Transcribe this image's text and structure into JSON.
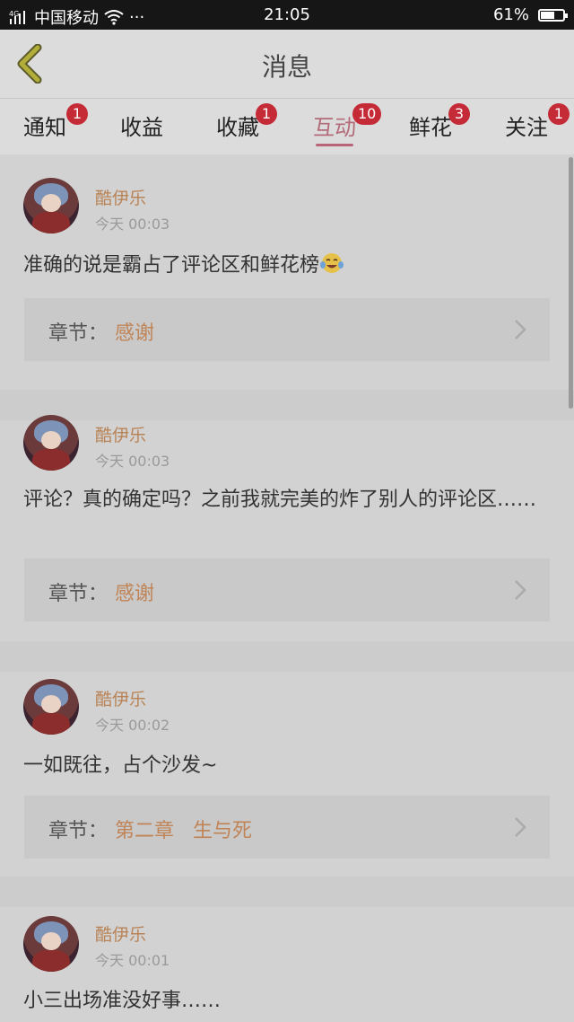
{
  "status_bar": {
    "signal_label": "4G",
    "carrier": "中国移动",
    "dots": "···",
    "time": "21:05",
    "battery_percent": "61%",
    "battery_level": 0.61
  },
  "header": {
    "title": "消息"
  },
  "tabs": [
    {
      "label": "通知",
      "badge": "1"
    },
    {
      "label": "收益",
      "badge": ""
    },
    {
      "label": "收藏",
      "badge": "1"
    },
    {
      "label": "互动",
      "badge": "10",
      "active": true
    },
    {
      "label": "鲜花",
      "badge": "3"
    },
    {
      "label": "关注",
      "badge": "1"
    }
  ],
  "messages": [
    {
      "user": "酷伊乐",
      "time": "今天 00:03",
      "text": "准确的说是霸占了评论区和鲜花榜",
      "emoji": "laughing-crying-emoji",
      "chapter_label": "章节：",
      "chapter": "感谢"
    },
    {
      "user": "酷伊乐",
      "time": "今天 00:03",
      "text": "评论？真的确定吗？之前我就完美的炸了别人的评论区……",
      "chapter_label": "章节：",
      "chapter": "感谢"
    },
    {
      "user": "酷伊乐",
      "time": "今天 00:02",
      "text": "一如既往，占个沙发~",
      "chapter_label": "章节：",
      "chapter": "第二章   生与死"
    },
    {
      "user": "酷伊乐",
      "time": "今天 00:01",
      "text": "小三出场准没好事……"
    }
  ]
}
